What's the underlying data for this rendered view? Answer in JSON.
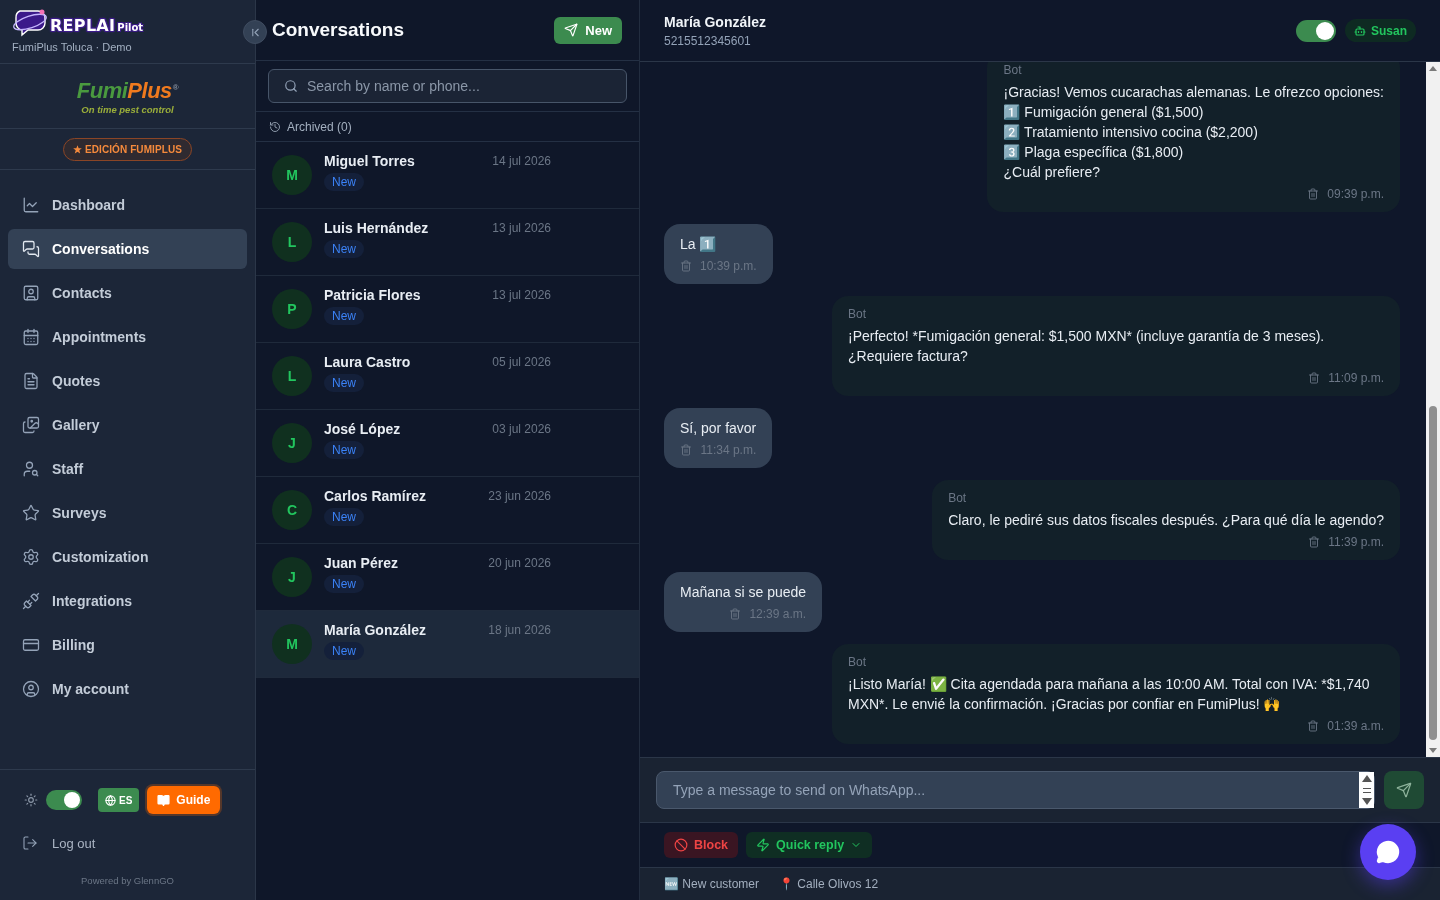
{
  "sidebar": {
    "brand": {
      "logo_text": "REPLAI",
      "logo_suffix": "Pilot",
      "workspace": "FumiPlus Toluca · Demo"
    },
    "client_logo": {
      "name_start": "Fumi",
      "name_end": "Plus",
      "registered_mark": "®",
      "tagline": "On time pest control"
    },
    "edition_badge": "EDICIÓN FUMIPLUS",
    "nav_items": [
      {
        "label": "Dashboard",
        "selected": false
      },
      {
        "label": "Conversations",
        "selected": true
      },
      {
        "label": "Contacts",
        "selected": false
      },
      {
        "label": "Appointments",
        "selected": false
      },
      {
        "label": "Quotes",
        "selected": false
      },
      {
        "label": "Gallery",
        "selected": false
      },
      {
        "label": "Staff",
        "selected": false
      },
      {
        "label": "Surveys",
        "selected": false
      },
      {
        "label": "Customization",
        "selected": false
      },
      {
        "label": "Integrations",
        "selected": false
      },
      {
        "label": "Billing",
        "selected": false
      },
      {
        "label": "My account",
        "selected": false
      }
    ],
    "theme_toggle": {
      "on": true
    },
    "language_button": "ES",
    "guide_button": "Guide",
    "logout": "Log out",
    "powered_by": "Powered by GlennGO"
  },
  "conversation_list": {
    "title": "Conversations",
    "new_button": "New",
    "search": {
      "placeholder": "Search by name or phone..."
    },
    "archived": "Archived (0)",
    "items": [
      {
        "initial": "M",
        "name": "Miguel Torres",
        "date": "14 jul 2026",
        "tag": "New",
        "selected": false
      },
      {
        "initial": "L",
        "name": "Luis Hernández",
        "date": "13 jul 2026",
        "tag": "New",
        "selected": false
      },
      {
        "initial": "P",
        "name": "Patricia Flores",
        "date": "13 jul 2026",
        "tag": "New",
        "selected": false
      },
      {
        "initial": "L",
        "name": "Laura Castro",
        "date": "05 jul 2026",
        "tag": "New",
        "selected": false
      },
      {
        "initial": "J",
        "name": "José López",
        "date": "03 jul 2026",
        "tag": "New",
        "selected": false
      },
      {
        "initial": "C",
        "name": "Carlos Ramírez",
        "date": "23 jun 2026",
        "tag": "New",
        "selected": false
      },
      {
        "initial": "J",
        "name": "Juan Pérez",
        "date": "20 jun 2026",
        "tag": "New",
        "selected": false
      },
      {
        "initial": "M",
        "name": "María González",
        "date": "18 jun 2026",
        "tag": "New",
        "selected": true
      }
    ]
  },
  "chat": {
    "contact_name": "María González",
    "phone": "5215512345601",
    "bot_toggle": {
      "on": true
    },
    "agent": "Susan",
    "messages": [
      {
        "kind": "bot",
        "sender": "Bot",
        "text": "¡Gracias! Vemos cucarachas alemanas. Le ofrezco opciones:\n1️⃣ Fumigación general ($1,500)\n2️⃣ Tratamiento intensivo cocina ($2,200)\n3️⃣ Plaga específica ($1,800)\n¿Cuál prefiere?",
        "time": "09:39 p.m."
      },
      {
        "kind": "customer",
        "text": "La 1️⃣",
        "time": "10:39 p.m."
      },
      {
        "kind": "bot",
        "sender": "Bot",
        "text": "¡Perfecto! *Fumigación general: $1,500 MXN* (incluye garantía de 3 meses). ¿Requiere factura?",
        "time": "11:09 p.m."
      },
      {
        "kind": "customer",
        "text": "Sí, por favor",
        "time": "11:34 p.m."
      },
      {
        "kind": "bot",
        "sender": "Bot",
        "text": "Claro, le pediré sus datos fiscales después. ¿Para qué día le agendo?",
        "time": "11:39 p.m."
      },
      {
        "kind": "customer",
        "text": "Mañana si se puede",
        "time": "12:39 a.m."
      },
      {
        "kind": "bot",
        "sender": "Bot",
        "text": "¡Listo María! ✅ Cita agendada para mañana a las 10:00 AM. Total con IVA: *$1,740 MXN*. Le envié la confirmación. ¡Gracias por confiar en FumiPlus! 🙌",
        "time": "01:39 a.m."
      }
    ],
    "composer": {
      "placeholder": "Type a message to send on WhatsApp..."
    },
    "actions": [
      {
        "kind": "block",
        "label": "Block"
      },
      {
        "kind": "quick_reply",
        "label": "Quick reply"
      }
    ],
    "footer": [
      "🆕 New customer",
      "📍 Calle Olivos 12"
    ]
  }
}
